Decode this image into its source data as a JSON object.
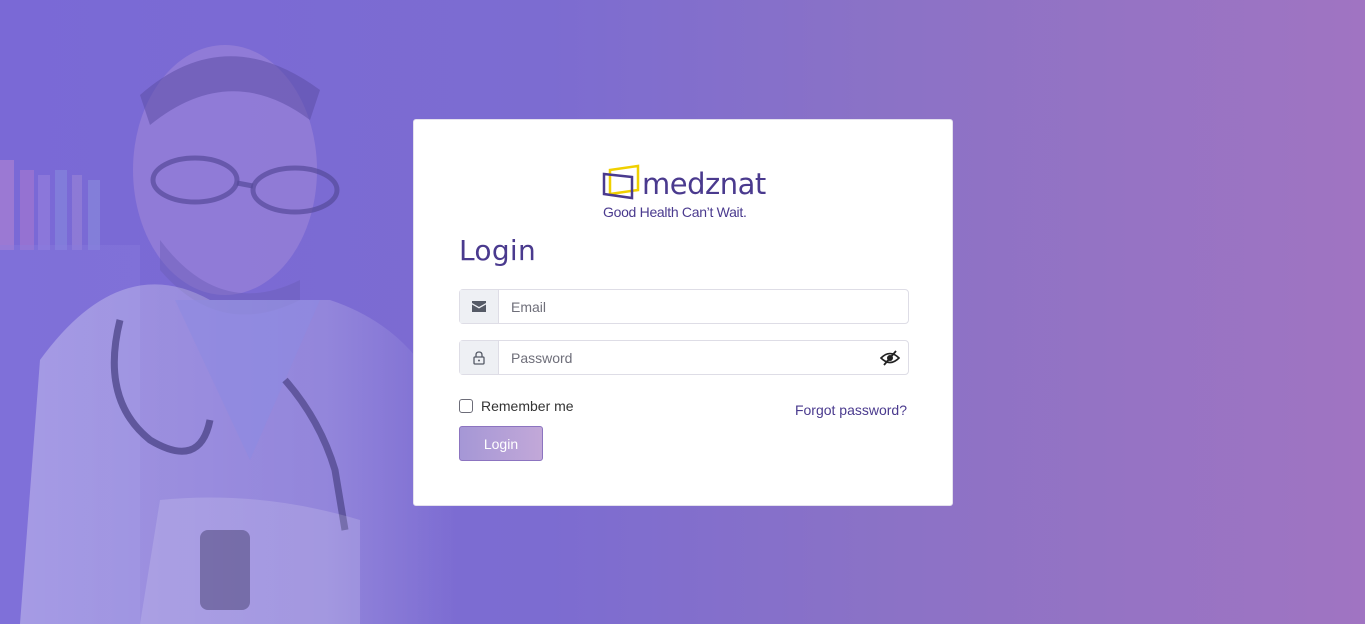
{
  "brand": {
    "name": "medznat",
    "tagline": "Good Health Can’t Wait.",
    "primary_color": "#4a3a8e",
    "accent_color": "#f0d000"
  },
  "login": {
    "title": "Login",
    "email_placeholder": "Email",
    "password_placeholder": "Password",
    "remember_label": "Remember me",
    "remember_checked": false,
    "forgot_label": "Forgot password?",
    "submit_label": "Login"
  },
  "icons": {
    "email": "envelope-icon",
    "password": "lock-icon",
    "toggle_password": "eye-slash-icon"
  }
}
